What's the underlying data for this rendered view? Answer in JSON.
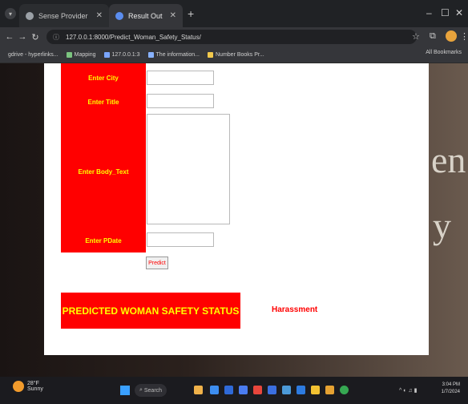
{
  "browser": {
    "tabs": [
      {
        "title": "Sense Provider",
        "active": false
      },
      {
        "title": "Result Out",
        "active": true
      }
    ],
    "new_tab_label": "+",
    "url": "127.0.0.1:8000/Predict_Woman_Safety_Status/",
    "bookmarks": [
      "gdrive - hyperlinks...",
      "Mapping",
      "127.0.0.1:3",
      "The information...",
      "Number Books Pr..."
    ],
    "all_bookmarks_label": "All Bookmarks"
  },
  "form": {
    "labels": {
      "city": "Enter City",
      "title": "Enter Title",
      "body_text": "Enter Body_Text",
      "pdate": "Enter PDate"
    },
    "values": {
      "city": "",
      "title": "",
      "body_text": "",
      "pdate": ""
    },
    "predict_button": "Predict"
  },
  "result": {
    "heading": "PREDICTED WOMAN SAFETY STATUS",
    "value": "Harassment"
  },
  "background_text": [
    "en",
    "y"
  ],
  "taskbar": {
    "weather_temp": "28°F",
    "weather_desc": "Sunny",
    "search_label": "Search",
    "clock_time": "3:04 PM",
    "clock_date": "1/7/2024"
  },
  "colors": {
    "label_bg": "#ff0000",
    "label_text": "#ffff00",
    "result_text": "#ff0000"
  }
}
